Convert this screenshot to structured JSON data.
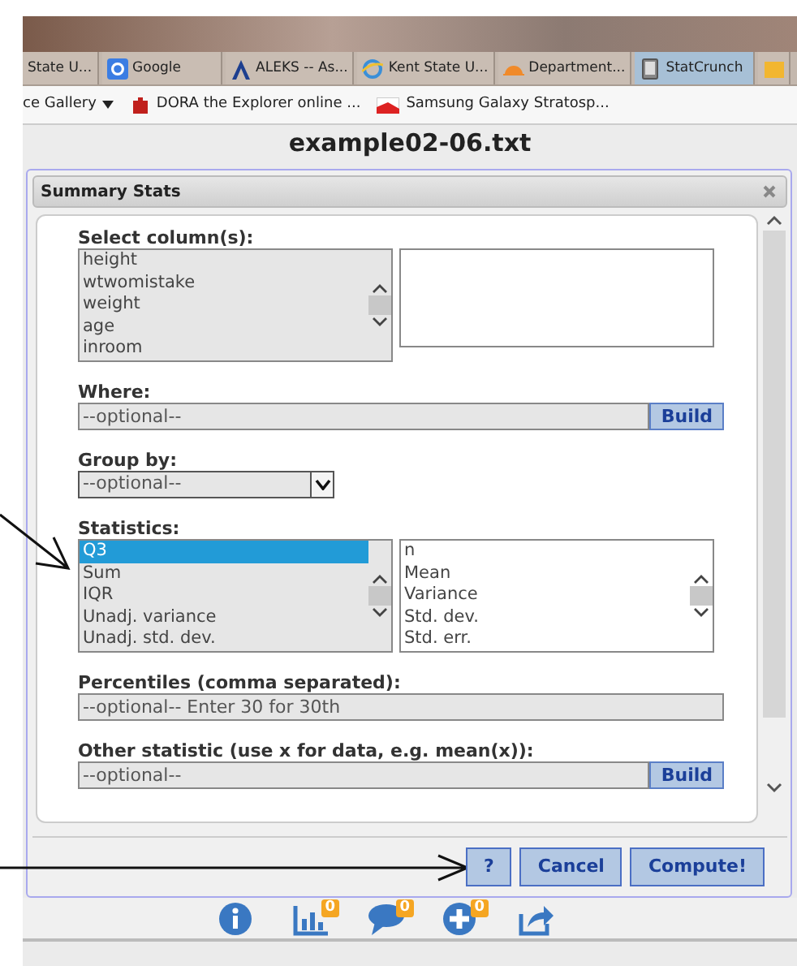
{
  "browser": {
    "tabs": [
      {
        "label": "State U...",
        "kind": "plain",
        "selected": false
      },
      {
        "label": "Google",
        "kind": "google",
        "selected": false
      },
      {
        "label": "ALEKS -- As...",
        "kind": "aleks",
        "selected": false
      },
      {
        "label": "Kent State U...",
        "kind": "ie",
        "selected": false
      },
      {
        "label": "Department...",
        "kind": "sun",
        "selected": false
      },
      {
        "label": "StatCrunch",
        "kind": "tablet",
        "selected": true
      },
      {
        "kind": "folder",
        "selected": false
      }
    ],
    "bookmarks": [
      {
        "label": "ce Gallery",
        "kind": "dropdown"
      },
      {
        "label": "DORA the Explorer online ...",
        "kind": "puzzle"
      },
      {
        "label": "Samsung Galaxy Stratosp...",
        "kind": "flag"
      }
    ],
    "page_title": "example02-06.txt"
  },
  "dialog": {
    "title": "Summary Stats",
    "fields": [
      {
        "kind": "listpair",
        "label": "Select column(s):",
        "items": [
          {
            "text": "height",
            "selected": false
          },
          {
            "text": "wtwomistake",
            "selected": false
          },
          {
            "text": "weight",
            "selected": false
          },
          {
            "text": "age",
            "selected": false
          },
          {
            "text": "inroom",
            "selected": false
          }
        ]
      },
      {
        "kind": "build",
        "label": "Where:",
        "placeholder": "--optional--",
        "button": "Build"
      },
      {
        "kind": "select",
        "label": "Group by:",
        "value": "--optional--"
      },
      {
        "kind": "listpair",
        "label": "Statistics:",
        "items": [
          {
            "text": "Q3",
            "selected": true
          },
          {
            "text": "Sum",
            "selected": false
          },
          {
            "text": "IQR",
            "selected": false
          },
          {
            "text": "Unadj. variance",
            "selected": false
          },
          {
            "text": "Unadj. std. dev.",
            "selected": false
          }
        ],
        "chosen": [
          {
            "text": "n",
            "selected": false
          },
          {
            "text": "Mean",
            "selected": false
          },
          {
            "text": "Variance",
            "selected": false
          },
          {
            "text": "Std. dev.",
            "selected": false
          },
          {
            "text": "Std. err.",
            "selected": false
          }
        ]
      },
      {
        "kind": "input",
        "label": "Percentiles (comma separated):",
        "placeholder": "--optional-- Enter 30 for 30th"
      },
      {
        "kind": "build",
        "label": "Other statistic (use x for data, e.g. mean(x)):",
        "placeholder": "--optional--",
        "button": "Build"
      }
    ],
    "buttons": [
      "?",
      "Cancel",
      "Compute!"
    ]
  },
  "toolbar": [
    {
      "kind": "info"
    },
    {
      "kind": "chart",
      "badge": "0"
    },
    {
      "kind": "comment",
      "badge": "0"
    },
    {
      "kind": "plus",
      "badge": "0"
    },
    {
      "kind": "share"
    }
  ]
}
